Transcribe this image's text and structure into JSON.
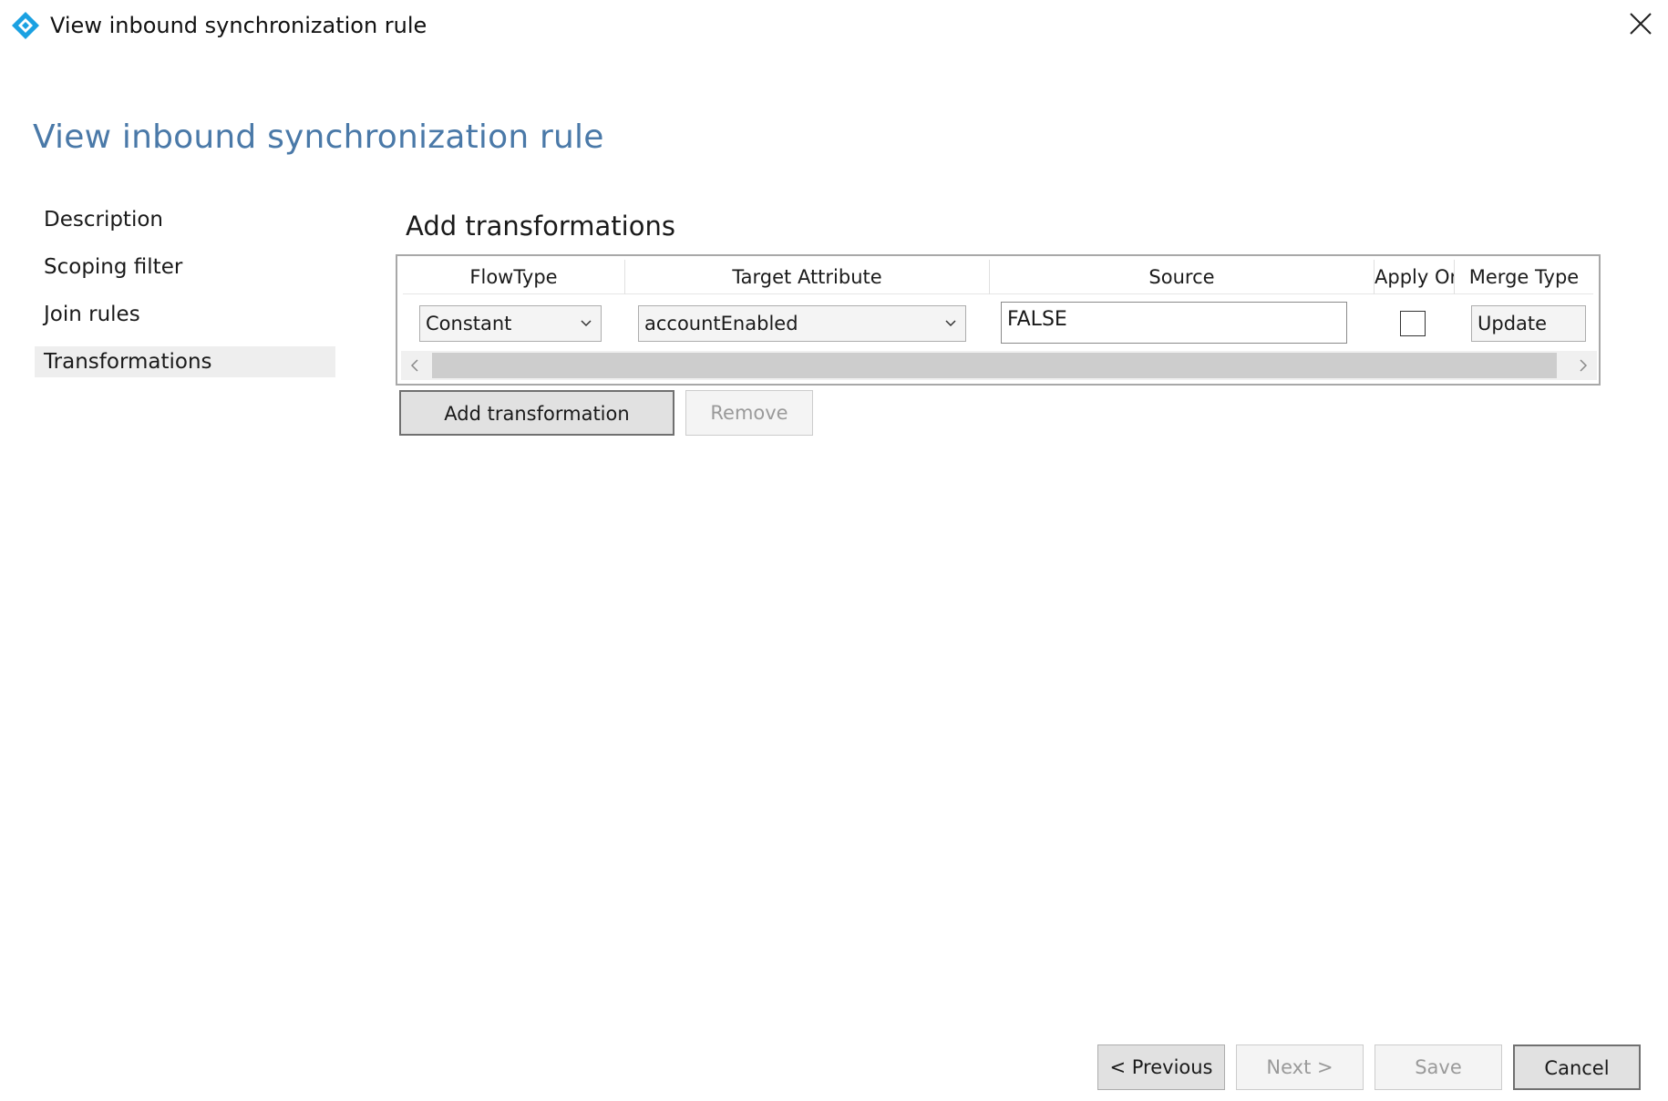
{
  "window": {
    "title": "View inbound synchronization rule",
    "close_icon": "close-icon",
    "app_icon": "sync-diamond-icon",
    "accent_color": "#1ba1e2"
  },
  "page": {
    "title": "View inbound synchronization rule",
    "title_color": "#4a79a8"
  },
  "nav": {
    "items": [
      {
        "label": "Description",
        "selected": false
      },
      {
        "label": "Scoping filter",
        "selected": false
      },
      {
        "label": "Join rules",
        "selected": false
      },
      {
        "label": "Transformations",
        "selected": true
      }
    ]
  },
  "main": {
    "section_title": "Add transformations",
    "grid": {
      "columns": [
        "FlowType",
        "Target Attribute",
        "Source",
        "Apply Or",
        "Merge Type"
      ],
      "rows": [
        {
          "flow_type": "Constant",
          "target_attribute": "accountEnabled",
          "source": "FALSE",
          "apply_once": false,
          "merge_type": "Update"
        }
      ]
    },
    "add_button": "Add transformation",
    "remove_button": "Remove"
  },
  "footer": {
    "previous": "< Previous",
    "next": "Next >",
    "save": "Save",
    "cancel": "Cancel"
  }
}
